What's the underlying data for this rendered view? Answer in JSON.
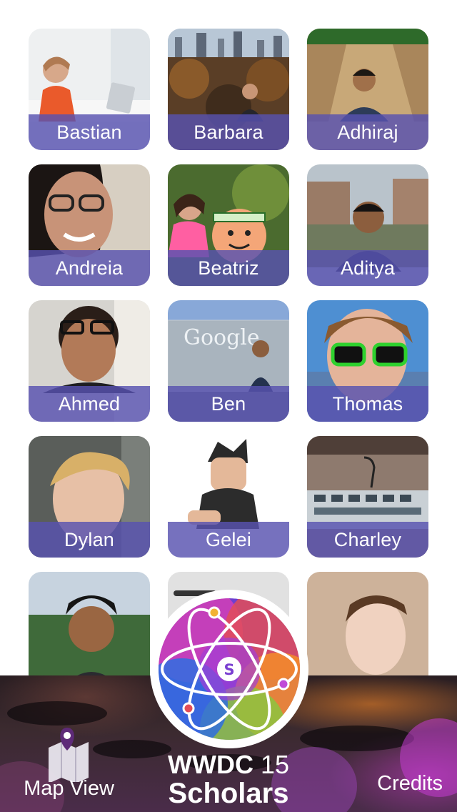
{
  "scholars": [
    {
      "name": "Bastian"
    },
    {
      "name": "Barbara"
    },
    {
      "name": "Adhiraj"
    },
    {
      "name": "Andreia"
    },
    {
      "name": "Beatriz"
    },
    {
      "name": "Aditya"
    },
    {
      "name": "Ahmed"
    },
    {
      "name": "Ben"
    },
    {
      "name": "Thomas"
    },
    {
      "name": "Dylan"
    },
    {
      "name": "Gelei"
    },
    {
      "name": "Charley"
    }
  ],
  "footer": {
    "map_label": "Map View",
    "credits_label": "Credits",
    "brand_line1_a": "WWDC",
    "brand_line1_b": " 15",
    "brand_line2": "Scholars",
    "logo_letter": "S"
  },
  "photo_text": {
    "google_sign": "Google"
  },
  "colors": {
    "label_bar": "#5852B0",
    "logo_ring": "#ffffff"
  }
}
